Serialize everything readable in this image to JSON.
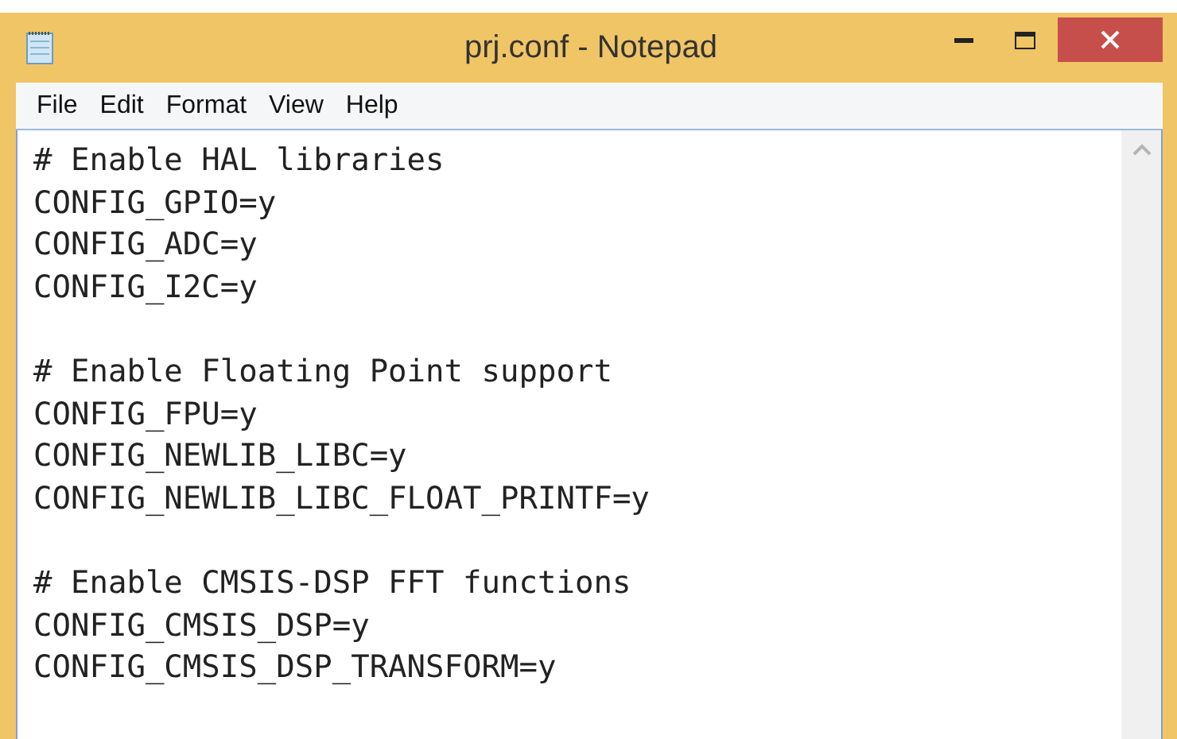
{
  "window": {
    "title": "prj.conf - Notepad"
  },
  "menu": [
    "File",
    "Edit",
    "Format",
    "View",
    "Help"
  ],
  "editor": {
    "blocks": [
      [
        "# Enable HAL libraries",
        "CONFIG_GPIO=y",
        "CONFIG_ADC=y",
        "CONFIG_I2C=y"
      ],
      [
        "# Enable Floating Point support",
        "CONFIG_FPU=y",
        "CONFIG_NEWLIB_LIBC=y",
        "CONFIG_NEWLIB_LIBC_FLOAT_PRINTF=y"
      ],
      [
        "# Enable CMSIS-DSP FFT functions",
        "CONFIG_CMSIS_DSP=y",
        "CONFIG_CMSIS_DSP_TRANSFORM=y"
      ]
    ]
  }
}
